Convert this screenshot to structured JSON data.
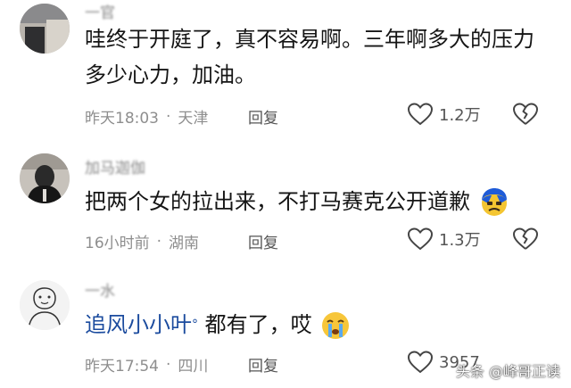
{
  "comments": [
    {
      "username": "一官",
      "text_lines": [
        "哇终于开庭了，真不容易啊。三年啊多大的压力",
        "多少心力，加油。"
      ],
      "time": "昨天18:03",
      "location": "天津",
      "reply_label": "回复",
      "likes": "1.2万"
    },
    {
      "username": "加马迦伽",
      "text": "把两个女的拉出来，不打马赛克公开道歉",
      "time": "16小时前",
      "location": "湖南",
      "reply_label": "回复",
      "likes": "1.3万",
      "emoji": "angry-face-emoji"
    },
    {
      "username": "一水",
      "mention": "追风小小叶",
      "text": "都有了，哎",
      "time": "昨天17:54",
      "location": "四川",
      "reply_label": "回复",
      "likes": "3957",
      "emoji": "crying-face-emoji"
    }
  ],
  "watermark": "头条 @峰哥正读",
  "colors": {
    "mention": "#1b4b9e",
    "meta": "#8e8e8e"
  }
}
